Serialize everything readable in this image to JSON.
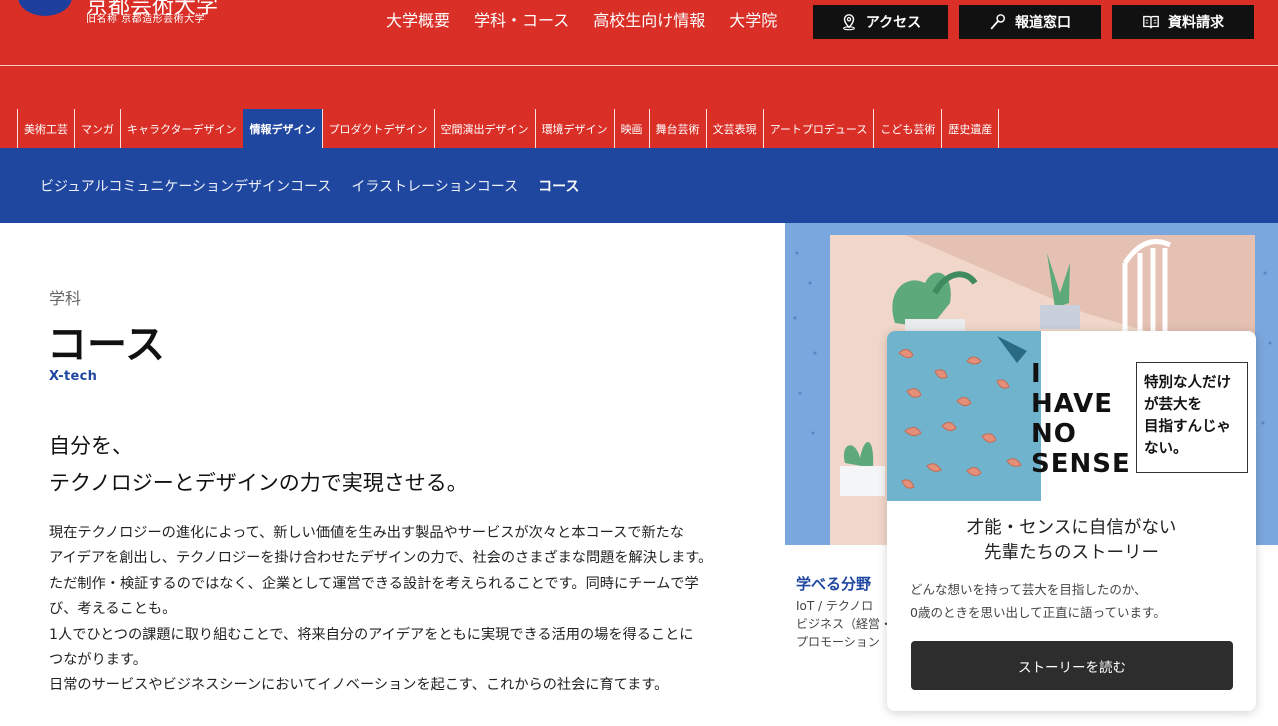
{
  "header": {
    "logo_main": "京都芸術大学",
    "logo_sub": "旧名称 京都造形芸術大学",
    "nav": [
      "大学概要",
      "学科・コース",
      "高校生向け情報",
      "大学院"
    ],
    "buttons": {
      "access": "アクセス",
      "press": "報道窓口",
      "request": "資料請求"
    }
  },
  "departments": [
    "美術工芸",
    "マンガ",
    "キャラクターデザイン",
    "情報デザイン",
    "プロダクトデザイン",
    "空間演出デザイン",
    "環境デザイン",
    "映画",
    "舞台芸術",
    "文芸表現",
    "アートプロデュース",
    "こども芸術",
    "歴史遺産"
  ],
  "active_department": "情報デザイン",
  "courses": [
    "ビジュアルコミュニケーションデザインコース",
    "イラストレーションコース",
    "コース"
  ],
  "main": {
    "dept_label": "学科",
    "title": "コース",
    "subtitle_en": "X-tech",
    "lead": [
      "自分を、",
      "テクノロジーとデザインの力で実現させる。"
    ],
    "body": [
      "現在テクノロジーの進化によって、新しい価値を生み出す製品やサービスが次々と本コースで新たな",
      "アイデアを創出し、テクノロジーを掛け合わせたデザインの力で、社会のさまざまな問題を解決します。",
      "ただ制作・検証するのではなく、企業として運営できる設計を考えられることです。同時にチームで学",
      "び、考えることも。",
      "1人でひとつの課題に取り組むことで、将来自分のアイデアをともに実現できる活用の場を得ることに",
      "つながります。",
      "日常のサービスやビジネスシーンにおいてイノベーションを起こす、これからの社会に育てます。"
    ],
    "fields_heading": "学べる分野",
    "fields_lines": [
      "IoT  /  テクノロ",
      "ビジネス（経営・",
      "プロモーション"
    ]
  },
  "story_card": {
    "img_text_lines": [
      "I",
      "HAVE",
      "NO",
      "SENSE"
    ],
    "box_lines": [
      "特別な人だけ",
      "が芸大を",
      "目指すんじゃ",
      "ない。"
    ],
    "title_lines": [
      "才能・センスに自信がない",
      "先輩たちのストーリー"
    ],
    "desc_lines": [
      "どんな想いを持って芸大を目指したのか、",
      "0歳のときを思い出して正直に語っています。"
    ],
    "button_label": "ストーリーを読む"
  },
  "colors": {
    "brand_red": "#d92f27",
    "brand_blue": "#1f47a0",
    "card_button": "#2d2d2d"
  },
  "icons": {
    "access": "map-pin-icon",
    "press": "microphone-icon",
    "request": "book-icon"
  }
}
